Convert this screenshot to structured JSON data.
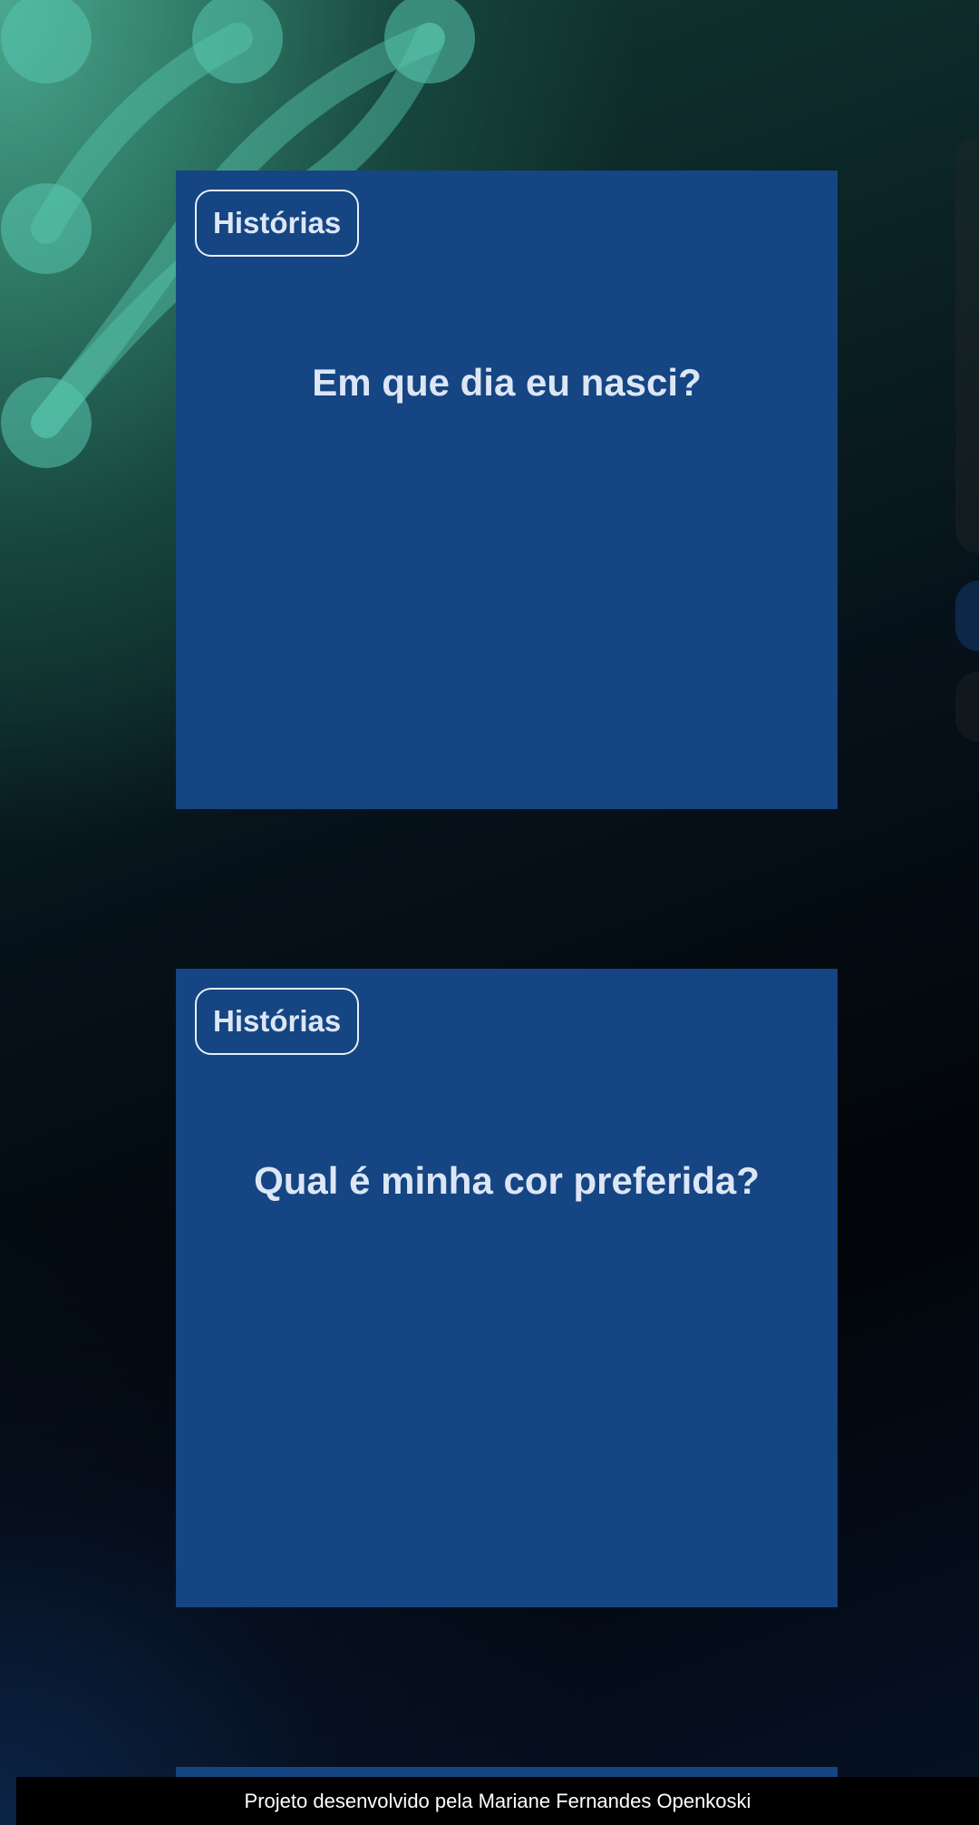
{
  "cards": [
    {
      "tag": "Histórias",
      "question": "Em que dia eu nasci?"
    },
    {
      "tag": "Histórias",
      "question": "Qual é minha cor preferida?"
    }
  ],
  "footer": {
    "text": "Projeto desenvolvido pela Mariane Fernandes Openkoski"
  },
  "colors": {
    "card_background": "#154582",
    "card_text": "#dce6f5",
    "background_teal": "#4aa88e",
    "background_dark": "#020509"
  }
}
